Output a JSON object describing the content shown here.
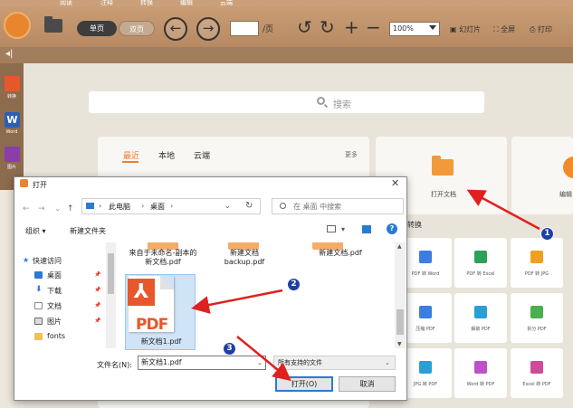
{
  "menubar": {
    "tabs": [
      "阅读",
      "注释",
      "转换",
      "编辑",
      "云端"
    ]
  },
  "toolbar": {
    "single_page": "单页",
    "double_page": "双页",
    "page_suffix": "/页",
    "zoom": "100%",
    "slideshow": "幻灯片",
    "fullscreen": "全屏",
    "print": "打印"
  },
  "sidebar": {
    "items": [
      {
        "label": "转换",
        "color": "#e8572b"
      },
      {
        "label": "Word",
        "color": "#2b5fb3"
      },
      {
        "label": "图片",
        "color": "#8a3ea8"
      }
    ]
  },
  "home": {
    "search_placeholder": "搜索",
    "recent_tabs": [
      "最近",
      "本地",
      "云端"
    ],
    "more": "更多",
    "open_doc": "打开文档",
    "edit_label": "编辑",
    "convert_heading": "转换",
    "tiles": [
      {
        "label": "PDF 转 Word",
        "color": "#3b7de0"
      },
      {
        "label": "PDF 转 Excel",
        "color": "#2fa05a"
      },
      {
        "label": "PDF 转 JPG",
        "color": "#f0a020"
      },
      {
        "label": "压缩 PDF",
        "color": "#3b7de0"
      },
      {
        "label": "解锁 PDF",
        "color": "#2a9fd6"
      },
      {
        "label": "拆分 PDF",
        "color": "#4cae4c"
      },
      {
        "label": "JPG 转 PDF",
        "color": "#2a9fd6"
      },
      {
        "label": "Word 转 PDF",
        "color": "#c050c8"
      },
      {
        "label": "Excel 转 PDF",
        "color": "#d04a9a"
      }
    ]
  },
  "dialog": {
    "title": "打开",
    "address": [
      "此电脑",
      "桌面"
    ],
    "search_placeholder": "在 桌面 中搜索",
    "organize": "组织 ▾",
    "new_folder": "新建文件夹",
    "nav": [
      {
        "label": "快速访问",
        "color": "#2a7ad4"
      },
      {
        "label": "桌面",
        "color": "#2a7ad4"
      },
      {
        "label": "下载",
        "color": "#2a7ad4"
      },
      {
        "label": "文档",
        "color": "#8a8a8a"
      },
      {
        "label": "图片",
        "color": "#8a8a8a"
      },
      {
        "label": "fonts",
        "color": "#f2c24a"
      }
    ],
    "files": {
      "top_row": [
        "来自于未命名-副本的新文档.pdf",
        "新建文档backup.pdf",
        "新建文档.pdf"
      ],
      "selected_icon_text": "PDF",
      "selected_name": "新文档1.pdf"
    },
    "filename_label": "文件名(N):",
    "filename_value": "新文档1.pdf",
    "filter_value": "所有支持的文件",
    "open_button": "打开(O)",
    "cancel_button": "取消"
  },
  "annotations": {
    "badges": [
      "1",
      "2",
      "3"
    ],
    "arrow_color": "#e02020"
  }
}
